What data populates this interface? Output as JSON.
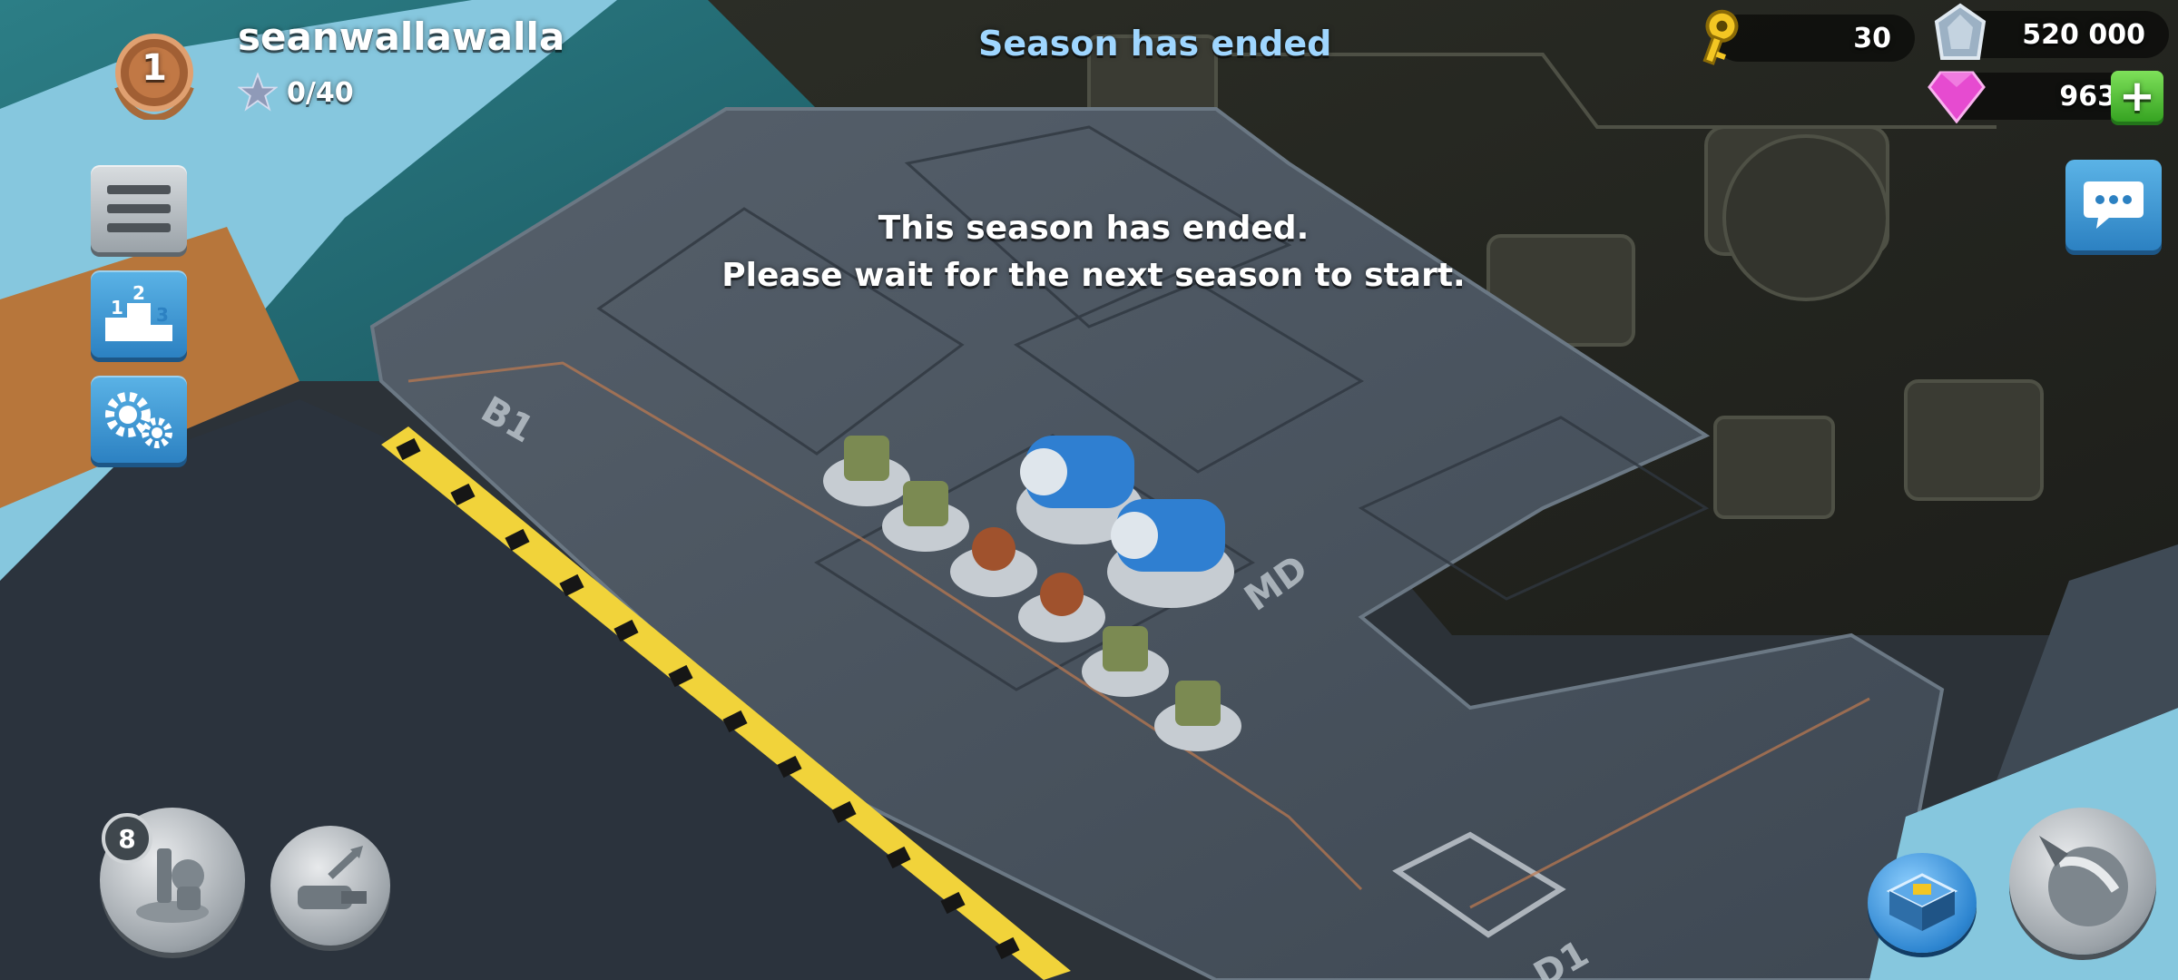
{
  "player": {
    "name": "seanwallawalla",
    "rank": "1",
    "stars": "0/40"
  },
  "season": {
    "title": "Season has ended",
    "message_line1": "This season has ended.",
    "message_line2": "Please wait for the next season to start."
  },
  "resources": {
    "keys": "30",
    "iron": "520 000",
    "gems": "963",
    "plus": "+"
  },
  "bottom": {
    "troops_count": "8"
  },
  "deck_labels": {
    "b1": "B1",
    "md": "MD",
    "d1": "D1"
  },
  "icons": [
    "rank-medal-icon",
    "star-icon",
    "menu-icon",
    "ranking-icon",
    "gear-icon",
    "key-icon",
    "iron-icon",
    "gem-icon",
    "plus-icon",
    "chat-icon",
    "troops-icon",
    "weapons-icon",
    "headquarters-icon",
    "attack-icon"
  ],
  "colors": {
    "accent_blue": "#2c81c2",
    "season_title": "#9fd6ff",
    "plus_green": "#36a322",
    "gem_pink": "#e64bd0",
    "key_gold": "#f3c623"
  }
}
